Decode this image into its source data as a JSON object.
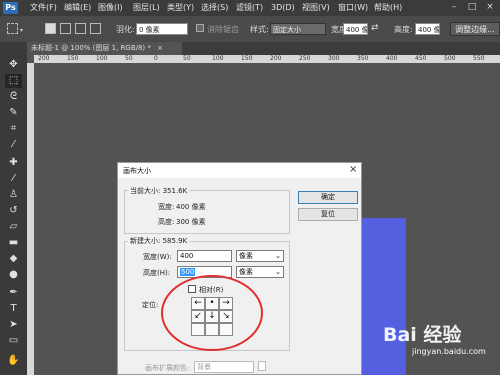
{
  "menubar": {
    "logo": "Ps",
    "items": [
      "文件(F)",
      "编辑(E)",
      "图像(I)",
      "图层(L)",
      "类型(Y)",
      "选择(S)",
      "滤镜(T)",
      "3D(D)",
      "视图(V)",
      "窗口(W)",
      "帮助(H)"
    ]
  },
  "options": {
    "feather_label": "羽化:",
    "feather_value": "0 像素",
    "antialias_label": "消除锯齿",
    "style_label": "样式:",
    "style_value": "固定大小",
    "width_label": "宽度:",
    "width_value": "400 像",
    "height_label": "高度:",
    "height_value": "400 像",
    "refine_edge": "调整边缘..."
  },
  "document_tab": {
    "label": "未标题-1 @ 100% (图层 1, RGB/8) *",
    "close": "×"
  },
  "ruler": {
    "ticks": [
      "200",
      "150",
      "100",
      "50",
      "0",
      "50",
      "100",
      "150",
      "200",
      "250",
      "300",
      "350",
      "400",
      "450",
      "500",
      "550"
    ]
  },
  "dialog": {
    "title": "画布大小",
    "close": "×",
    "current_size_label": "当前大小: 351.6K",
    "current_width_label": "宽度:",
    "current_width_value": "400 像素",
    "current_height_label": "高度:",
    "current_height_value": "300 像素",
    "new_size_label": "新建大小: 585.9K",
    "width_label": "宽度(W):",
    "width_value": "400",
    "width_unit": "像素",
    "height_label": "高度(H):",
    "height_value": "500",
    "height_unit": "像素",
    "relative_label": "相对(R)",
    "anchor_label": "定位:",
    "ok_button": "确定",
    "reset_button": "复位",
    "extension_color_label": "画布扩展颜色:",
    "extension_color_value": "背景"
  },
  "watermark": {
    "logo": "Bai 经验",
    "url": "jingyan.baidu.com"
  },
  "colors": {
    "highlight_circle": "#e03030",
    "canvas_fill": "#5460e0",
    "accent": "#2c6fb6"
  }
}
